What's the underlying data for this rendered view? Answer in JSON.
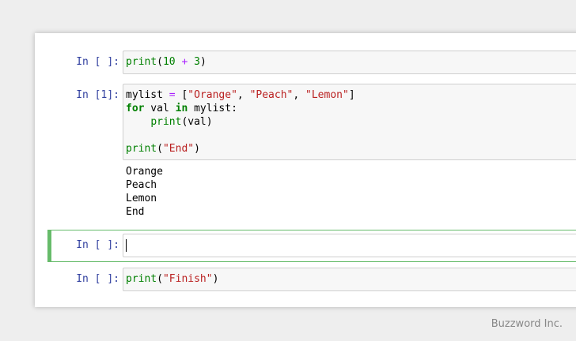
{
  "cells": [
    {
      "prompt": "In [ ]:",
      "code": [
        [
          {
            "t": "print",
            "c": "kw-builtin"
          },
          {
            "t": "(",
            "c": ""
          },
          {
            "t": "10",
            "c": "num"
          },
          {
            "t": " + ",
            "c": "op"
          },
          {
            "t": "3",
            "c": "num"
          },
          {
            "t": ")",
            "c": ""
          }
        ]
      ]
    },
    {
      "prompt": "In [1]:",
      "code": [
        [
          {
            "t": "mylist ",
            "c": ""
          },
          {
            "t": "=",
            "c": "op"
          },
          {
            "t": " [",
            "c": ""
          },
          {
            "t": "\"Orange\"",
            "c": "str"
          },
          {
            "t": ", ",
            "c": ""
          },
          {
            "t": "\"Peach\"",
            "c": "str"
          },
          {
            "t": ", ",
            "c": ""
          },
          {
            "t": "\"Lemon\"",
            "c": "str"
          },
          {
            "t": "]",
            "c": ""
          }
        ],
        [
          {
            "t": "for",
            "c": "kw"
          },
          {
            "t": " val ",
            "c": ""
          },
          {
            "t": "in",
            "c": "kw"
          },
          {
            "t": " mylist:",
            "c": ""
          }
        ],
        [
          {
            "t": "    ",
            "c": ""
          },
          {
            "t": "print",
            "c": "kw-builtin"
          },
          {
            "t": "(val)",
            "c": ""
          }
        ],
        [],
        [
          {
            "t": "print",
            "c": "kw-builtin"
          },
          {
            "t": "(",
            "c": ""
          },
          {
            "t": "\"End\"",
            "c": "str"
          },
          {
            "t": ")",
            "c": ""
          }
        ]
      ],
      "output": [
        "Orange",
        "Peach",
        "Lemon",
        "End"
      ]
    },
    {
      "prompt": "In [ ]:",
      "code": []
    },
    {
      "prompt": "In [ ]:",
      "code": [
        [
          {
            "t": "print",
            "c": "kw-builtin"
          },
          {
            "t": "(",
            "c": ""
          },
          {
            "t": "\"Finish\"",
            "c": "str"
          },
          {
            "t": ")",
            "c": ""
          }
        ]
      ]
    }
  ],
  "watermark": "Buzzword Inc.",
  "colors": {
    "prompt": "#303f9f",
    "selected_border": "#66bb6a",
    "builtin": "#008000",
    "string": "#ba2121",
    "operator": "#aa22ff"
  }
}
